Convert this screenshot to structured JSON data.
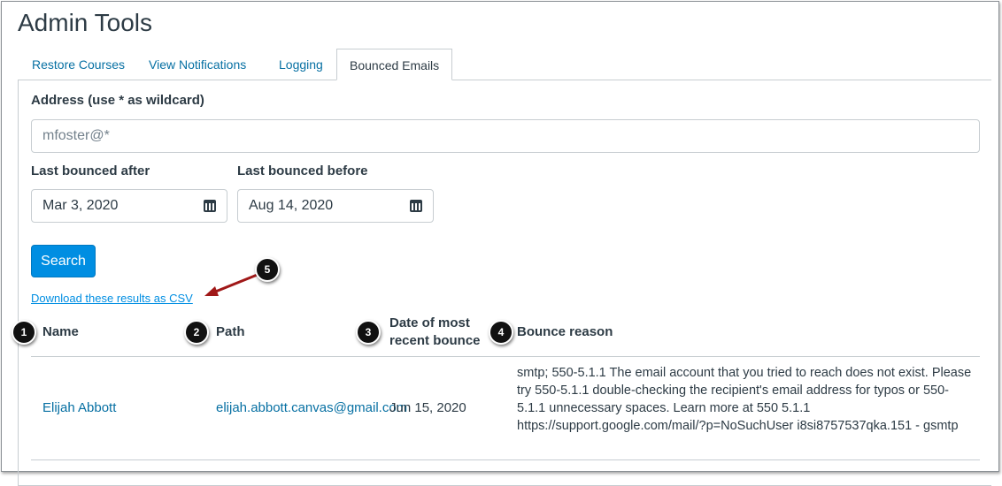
{
  "title": "Admin Tools",
  "tabs": [
    "Restore Courses",
    "View Notifications",
    "Logging",
    "Bounced Emails"
  ],
  "form": {
    "address_label": "Address (use * as wildcard)",
    "address_value": "mfoster@*",
    "after_label": "Last bounced after",
    "after_value": "Mar 3, 2020",
    "before_label": "Last bounced before",
    "before_value": "Aug 14, 2020",
    "search_label": "Search"
  },
  "download_link": "Download these results as CSV",
  "table": {
    "headers": [
      "Name",
      "Path",
      "Date of most recent bounce",
      "Bounce reason"
    ],
    "rows": [
      {
        "name": "Elijah Abbott",
        "path": "elijah.abbott.canvas@gmail.com",
        "date": "Jun 15, 2020",
        "reason": "smtp; 550-5.1.1 The email account that you tried to reach does not exist. Please try 550-5.1.1 double-checking the recipient's email address for typos or 550-5.1.1 unnecessary spaces. Learn more at 550 5.1.1 https://support.google.com/mail/?p=NoSuchUser i8si8757537qka.151 - gsmtp"
      }
    ]
  },
  "callouts": [
    "1",
    "2",
    "3",
    "4",
    "5"
  ],
  "colors": {
    "link": "#0770a3",
    "button": "#008ee2",
    "arrow": "#a01818"
  }
}
